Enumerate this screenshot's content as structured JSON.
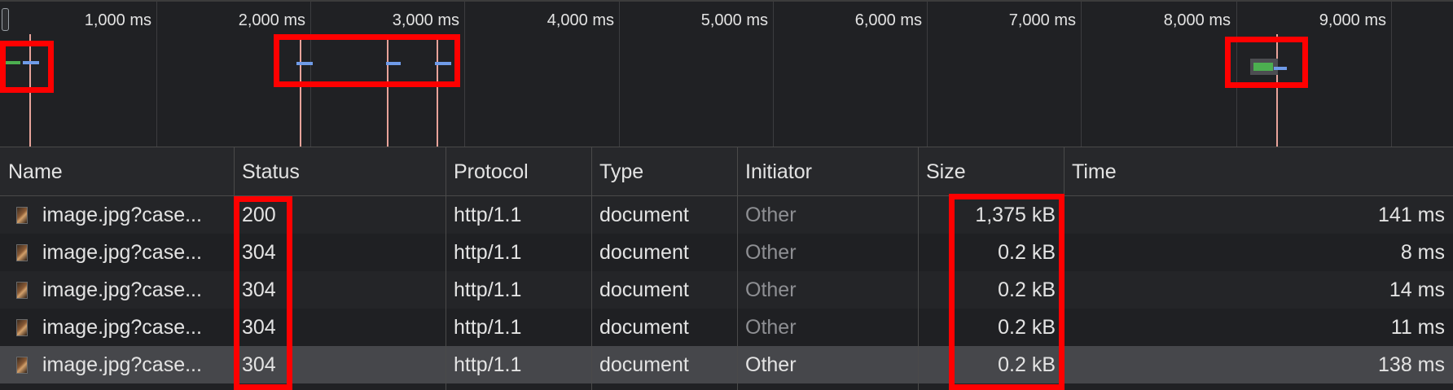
{
  "timeline": {
    "tick_labels": [
      "1,000 ms",
      "2,000 ms",
      "3,000 ms",
      "4,000 ms",
      "5,000 ms",
      "6,000 ms",
      "7,000 ms",
      "8,000 ms",
      "9,000 ms"
    ],
    "colors": {
      "waiting_bar": "#4caf50",
      "download_bar": "#6f9be8",
      "load_marker": "#e8a39a",
      "highlight": "#ff0000"
    }
  },
  "table": {
    "columns": [
      "Name",
      "Status",
      "Protocol",
      "Type",
      "Initiator",
      "Size",
      "Time"
    ],
    "rows": [
      {
        "name": "image.jpg?case...",
        "status": "200",
        "protocol": "http/1.1",
        "type": "document",
        "initiator": "Other",
        "size": "1,375 kB",
        "time": "141 ms"
      },
      {
        "name": "image.jpg?case...",
        "status": "304",
        "protocol": "http/1.1",
        "type": "document",
        "initiator": "Other",
        "size": "0.2 kB",
        "time": "8 ms"
      },
      {
        "name": "image.jpg?case...",
        "status": "304",
        "protocol": "http/1.1",
        "type": "document",
        "initiator": "Other",
        "size": "0.2 kB",
        "time": "14 ms"
      },
      {
        "name": "image.jpg?case...",
        "status": "304",
        "protocol": "http/1.1",
        "type": "document",
        "initiator": "Other",
        "size": "0.2 kB",
        "time": "11 ms"
      },
      {
        "name": "image.jpg?case...",
        "status": "304",
        "protocol": "http/1.1",
        "type": "document",
        "initiator": "Other",
        "size": "0.2 kB",
        "time": "138 ms"
      }
    ],
    "selected_row": 4
  }
}
